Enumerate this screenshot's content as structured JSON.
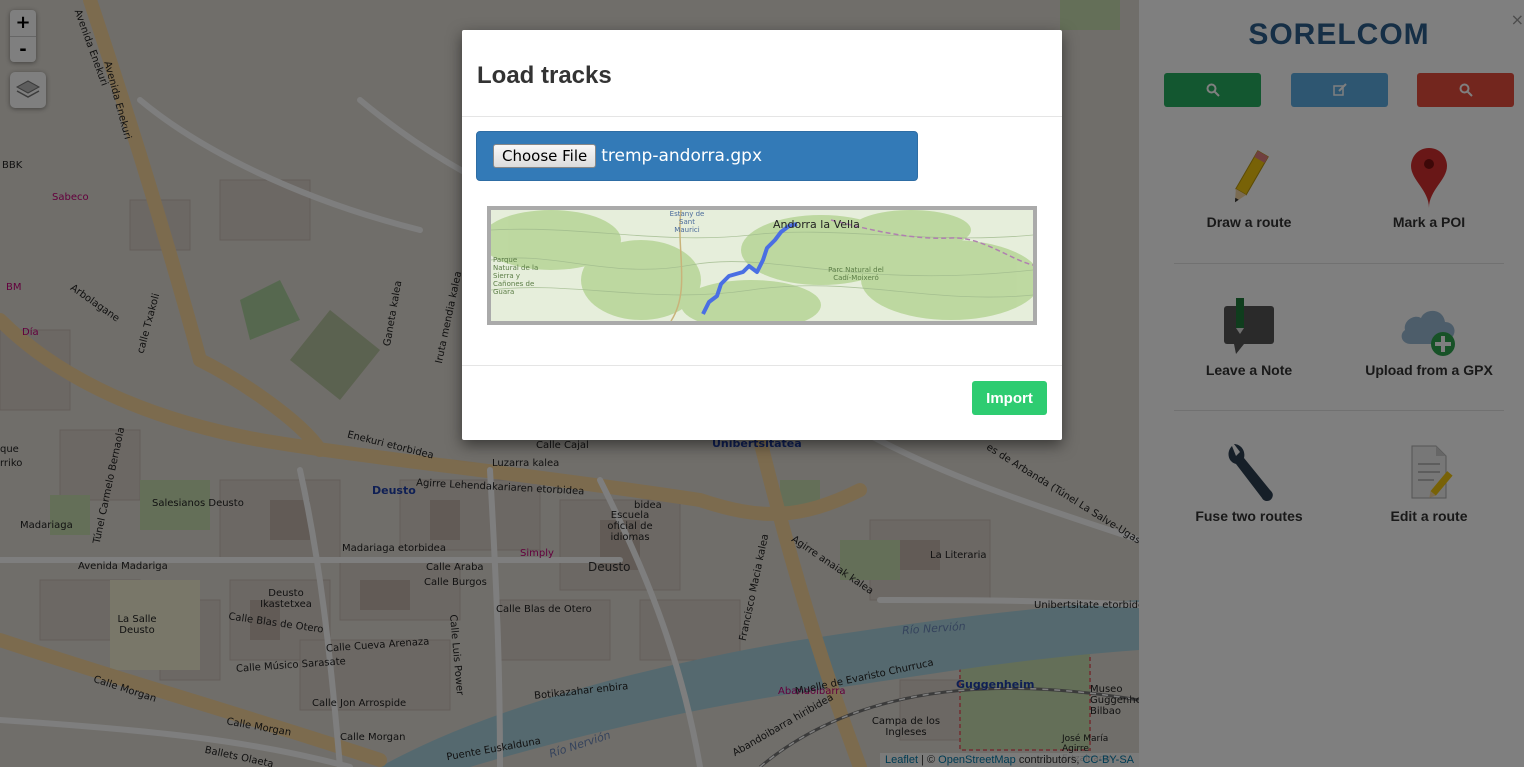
{
  "map": {
    "zoom_in": "+",
    "zoom_out": "-",
    "labels": [
      {
        "text": "Avenida Enekuri",
        "class": ""
      },
      {
        "text": "Avenida Enekuri",
        "class": ""
      },
      {
        "text": "BBK",
        "class": ""
      },
      {
        "text": "Sabeco",
        "class": "pink"
      },
      {
        "text": "BM",
        "class": "pink"
      },
      {
        "text": "Día",
        "class": "pink"
      },
      {
        "text": "Arbolagane",
        "class": ""
      },
      {
        "text": "calle Txakoli",
        "class": ""
      },
      {
        "text": "Ganeta kalea",
        "class": ""
      },
      {
        "text": "Iruta mendia kalea",
        "class": ""
      },
      {
        "text": "Enekuri etorbidea",
        "class": ""
      },
      {
        "text": "Túnel Carmelo Bernaola",
        "class": ""
      },
      {
        "text": "Luzarra kalea",
        "class": ""
      },
      {
        "text": "Deusto",
        "class": "blue"
      },
      {
        "text": "Agirre Lehendakariaren etorbidea",
        "class": ""
      },
      {
        "text": "Unibertsitatea",
        "class": "blue"
      },
      {
        "text": "Salesianos Deusto",
        "class": ""
      },
      {
        "text": "Avenida Madariga",
        "class": ""
      },
      {
        "text": "Madariaga etorbidea",
        "class": ""
      },
      {
        "text": "Calle Araba",
        "class": ""
      },
      {
        "text": "Calle Burgos",
        "class": ""
      },
      {
        "text": "Escuela oficial de idiomas",
        "class": ""
      },
      {
        "text": "Deusto",
        "class": "district"
      },
      {
        "text": "Simply",
        "class": "pink"
      },
      {
        "text": "Deusto Ikastetxea",
        "class": ""
      },
      {
        "text": "La Salle Deusto",
        "class": ""
      },
      {
        "text": "Calle Blas de Otero",
        "class": ""
      },
      {
        "text": "Calle Blas de Otero",
        "class": ""
      },
      {
        "text": "Calle Músico Sarasate",
        "class": ""
      },
      {
        "text": "Calle Cueva Arenaza",
        "class": ""
      },
      {
        "text": "Calle Jon Arrospide",
        "class": ""
      },
      {
        "text": "Botikazahar enbira",
        "class": ""
      },
      {
        "text": "Calle Morgan",
        "class": ""
      },
      {
        "text": "Calle Morgan",
        "class": ""
      },
      {
        "text": "Calle Morgan",
        "class": ""
      },
      {
        "text": "Río Nervión",
        "class": "river"
      },
      {
        "text": "Río Nervión",
        "class": "river"
      },
      {
        "text": "La Literaria",
        "class": ""
      },
      {
        "text": "Unibertsitate etorbidea",
        "class": ""
      },
      {
        "text": "Guggenheim",
        "class": "blue"
      },
      {
        "text": "Abandoibarra",
        "class": "pink"
      },
      {
        "text": "Campa de los Ingleses",
        "class": ""
      },
      {
        "text": "Museo Guggenheim Bilbao",
        "class": ""
      },
      {
        "text": "José María Agirre Ertzainaren",
        "class": ""
      },
      {
        "text": "Muelle de Evaristo Churruca",
        "class": ""
      },
      {
        "text": "Puente Euskalduna",
        "class": ""
      },
      {
        "text": "Abandoibarra hiribidea",
        "class": ""
      },
      {
        "text": "Calle Cajal",
        "class": ""
      },
      {
        "text": "Francisco Macia kalea",
        "class": ""
      },
      {
        "text": "Agirre anaiak kalea",
        "class": ""
      },
      {
        "text": "Calle Luis Power",
        "class": ""
      },
      {
        "text": "Madariaga",
        "class": ""
      },
      {
        "text": "Ballets Olaeta",
        "class": ""
      },
      {
        "text": "que",
        "class": ""
      },
      {
        "text": "rriko",
        "class": ""
      },
      {
        "text": "bidea",
        "class": ""
      },
      {
        "text": "es de Arbanda (Túnel La Salve-Ugasko)",
        "class": ""
      }
    ],
    "attribution": {
      "leaflet": "Leaflet",
      "sep": " | © ",
      "osm": "OpenStreetMap",
      "contributors": " contributors, ",
      "license": "CC-BY-SA"
    }
  },
  "sidebar": {
    "close": "×",
    "brand": "SORELCOM",
    "buttons": [
      {
        "icon": "search-icon",
        "color": "#27ae60"
      },
      {
        "icon": "edit-icon",
        "color": "#5dade2"
      },
      {
        "icon": "search-icon",
        "color": "#e74c3c"
      }
    ],
    "tools": [
      {
        "label": "Draw a route",
        "icon": "pencil-icon"
      },
      {
        "label": "Mark a POI",
        "icon": "map-pin-icon"
      },
      {
        "label": "Leave a Note",
        "icon": "note-icon"
      },
      {
        "label": "Upload from a GPX",
        "icon": "cloud-upload-icon"
      },
      {
        "label": "Fuse two routes",
        "icon": "wrench-icon"
      },
      {
        "label": "Edit a route",
        "icon": "document-edit-icon"
      }
    ]
  },
  "modal": {
    "title": "Load tracks",
    "file_button": "Choose File",
    "file_name": "tremp-andorra.gpx",
    "preview_labels": {
      "place1": "Andorra la Vella",
      "place2": "Parque Natural de la Sierra y Cañones de Guara",
      "place3": "Parc Natural del Cadí-Moixeró",
      "place4": "Estany de Sant Maurici"
    },
    "import_label": "Import"
  },
  "colors": {
    "brand": "#2c5f8c",
    "overlay": "rgba(0,0,0,0.5)",
    "file_field": "#337ab7",
    "import": "#2ecc71",
    "track": "#4a6fe3"
  }
}
